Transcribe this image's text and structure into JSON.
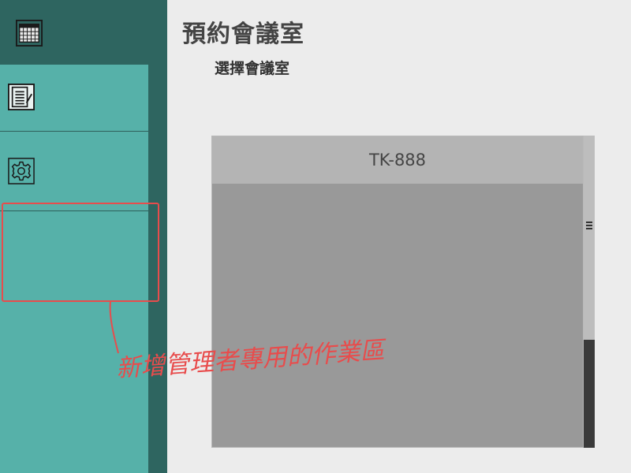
{
  "header": {
    "title": "預約會議室",
    "subtitle": "選擇會議室"
  },
  "sidebar": {
    "items": [
      {
        "icon": "calendar-icon"
      },
      {
        "icon": "notes-icon"
      },
      {
        "icon": "gear-icon"
      },
      {
        "label": ""
      }
    ]
  },
  "room": {
    "name": "TK-888"
  },
  "annotation": {
    "note": "新增管理者專用的作業區",
    "color": "#e84c4c"
  },
  "colors": {
    "sidebar_dark": "#2e6560",
    "sidebar_light": "#56b1a9",
    "background": "#ececec",
    "card": "#999999"
  }
}
